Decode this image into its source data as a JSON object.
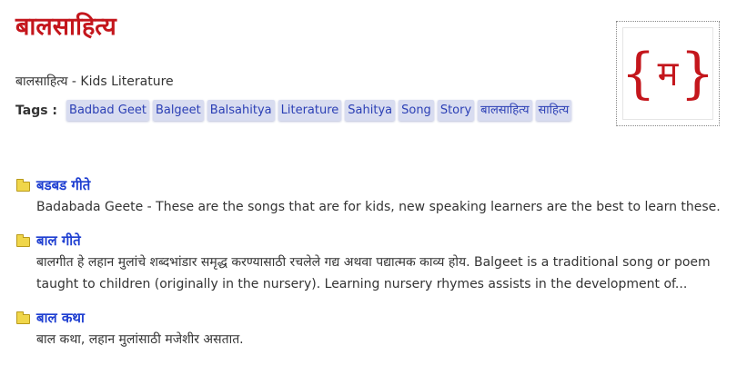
{
  "page": {
    "title": "बालसाहित्य",
    "subtitle": "बालसाहित्य - Kids Literature",
    "tags_label": "Tags :",
    "tags": [
      "Badbad Geet",
      "Balgeet",
      "Balsahitya",
      "Literature",
      "Sahitya",
      "Song",
      "Story",
      "बालसाहित्य",
      "साहित्य"
    ]
  },
  "logo": {
    "left_brace": "{",
    "letter": "म",
    "right_brace": "}"
  },
  "items": [
    {
      "title": "बडबड गीते",
      "description": "Badabada Geete - These are the songs that are for kids, new speaking learners are the best to learn these."
    },
    {
      "title": "बाल गीते",
      "description": "बालगीत हे लहान मुलांचे शब्दभांडार समृद्ध करण्यासाठी रचलेले गद्य अथवा पद्यात्मक काव्य होय. Balgeet is a traditional song or poem taught to children (originally in the nursery). Learning nursery rhymes assists in the development of..."
    },
    {
      "title": "बाल कथा",
      "description": "बाल कथा, लहान मुलांसाठी मजेशीर असतात."
    }
  ],
  "colors": {
    "title_red": "#c4161c",
    "link_blue": "#1f3fd1",
    "tag_bg": "#d8dcf0",
    "folder_yellow": "#f0d64a"
  }
}
